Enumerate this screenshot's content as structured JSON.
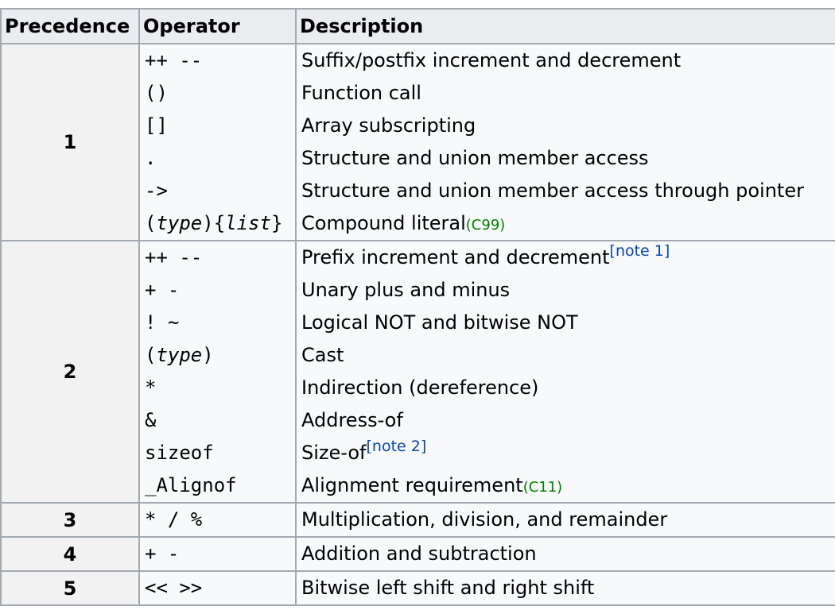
{
  "headers": {
    "precedence": "Precedence",
    "operator": "Operator",
    "description": "Description"
  },
  "groups": [
    {
      "precedence": "1",
      "rows": [
        {
          "operator": "++ --",
          "description": "Suffix/postfix increment and decrement"
        },
        {
          "operator": "()",
          "description": "Function call"
        },
        {
          "operator": "[]",
          "description": "Array subscripting"
        },
        {
          "operator": ".",
          "description": "Structure and union member access"
        },
        {
          "operator": "->",
          "description": "Structure and union member access through pointer"
        },
        {
          "operator_parts": [
            "(",
            "type",
            "){",
            "list",
            "}"
          ],
          "description": "Compound literal",
          "standard": "(C99)"
        }
      ]
    },
    {
      "precedence": "2",
      "rows": [
        {
          "operator": "++ --",
          "description": "Prefix increment and decrement",
          "note": "[note 1]"
        },
        {
          "operator": "+ -",
          "description": "Unary plus and minus"
        },
        {
          "operator": "! ~",
          "description": "Logical NOT and bitwise NOT"
        },
        {
          "operator_parts": [
            "(",
            "type",
            ")"
          ],
          "description": "Cast"
        },
        {
          "operator": "*",
          "description": "Indirection (dereference)"
        },
        {
          "operator": "&",
          "description": "Address-of"
        },
        {
          "operator": "sizeof",
          "description": "Size-of",
          "note": "[note 2]"
        },
        {
          "operator": "_Alignof",
          "description": "Alignment requirement",
          "standard": "(C11)"
        }
      ]
    },
    {
      "precedence": "3",
      "rows": [
        {
          "operator": "* / %",
          "description": "Multiplication, division, and remainder"
        }
      ]
    },
    {
      "precedence": "4",
      "rows": [
        {
          "operator": "+ -",
          "description": "Addition and subtraction"
        }
      ]
    },
    {
      "precedence": "5",
      "rows": [
        {
          "operator": "<< >>",
          "description": "Bitwise left shift and right shift"
        }
      ]
    }
  ],
  "colors": {
    "header_bg": "#eaecf0",
    "cell_bg": "#f8f9fa",
    "precedence_bg": "#f2f2f2",
    "border": "#a2a9b1",
    "standard_tag": "#008000",
    "note_link": "#0645ad"
  }
}
